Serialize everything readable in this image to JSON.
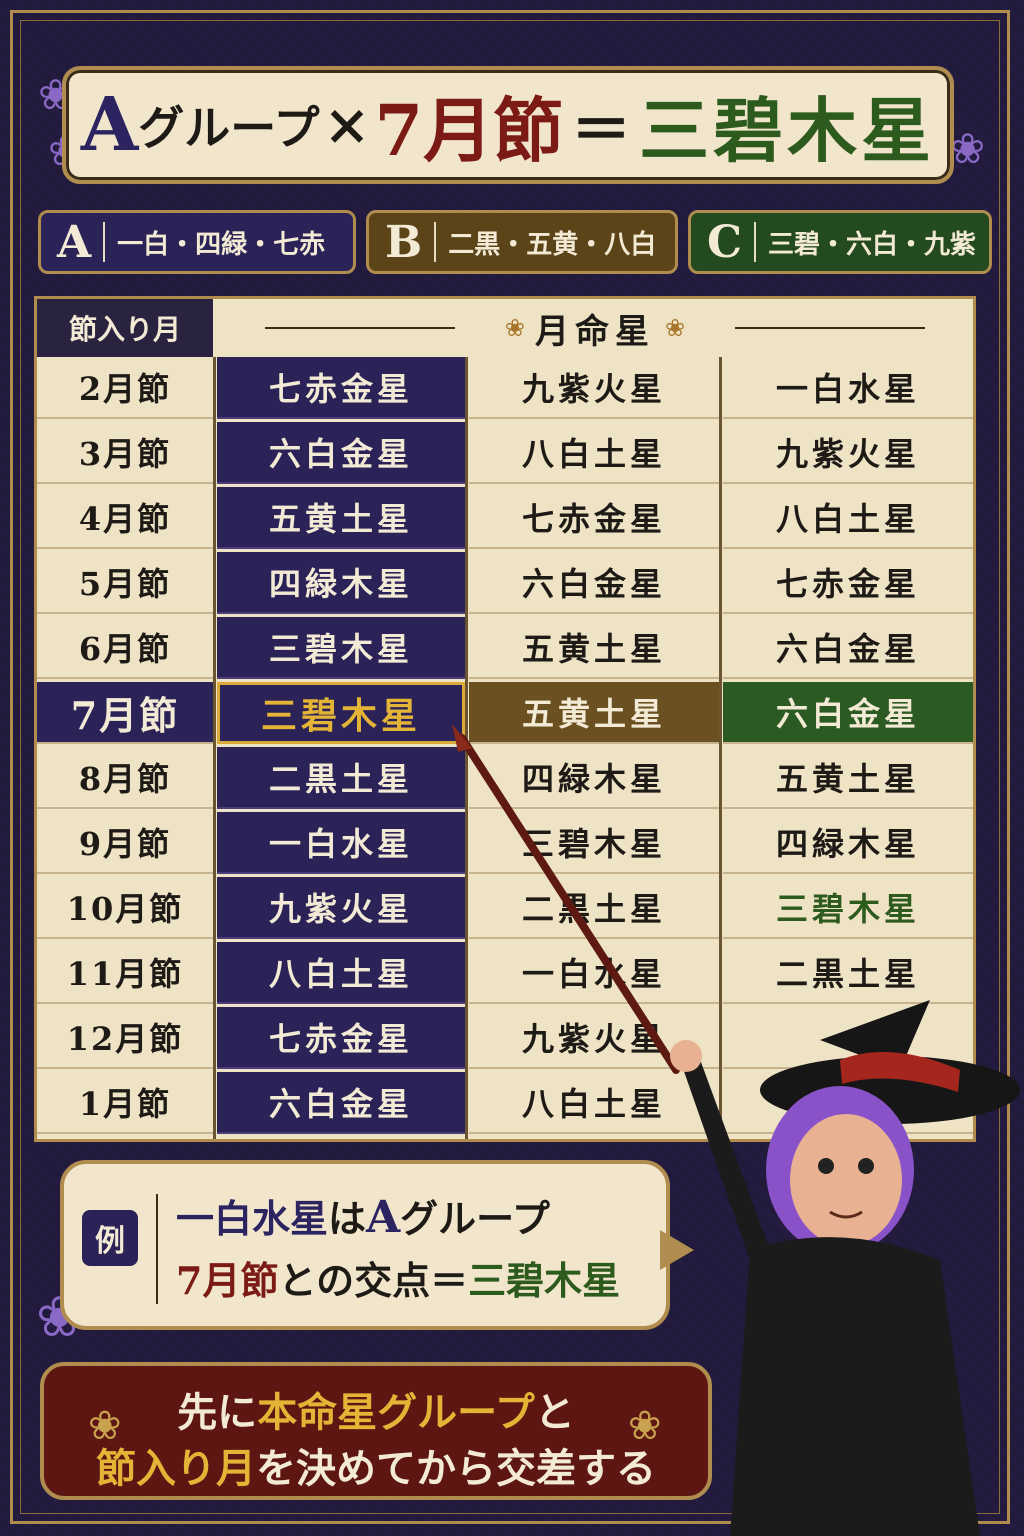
{
  "title": {
    "group_letter": "A",
    "group_word": "グループ",
    "times": "×",
    "month": "7月節",
    "equals": "＝",
    "result": "三碧木星"
  },
  "groups": [
    {
      "letter": "A",
      "stars": "一白・四緑・七赤",
      "color": "#2b2357"
    },
    {
      "letter": "B",
      "stars": "二黒・五黄・八白",
      "color": "#5c4419"
    },
    {
      "letter": "C",
      "stars": "三碧・六白・九紫",
      "color": "#244a1f"
    }
  ],
  "table": {
    "header_left": "節入り月",
    "header_right": "月命星",
    "rows": [
      {
        "month": "2月節",
        "a": "七赤金星",
        "b": "九紫火星",
        "c": "一白水星"
      },
      {
        "month": "3月節",
        "a": "六白金星",
        "b": "八白土星",
        "c": "九紫火星"
      },
      {
        "month": "4月節",
        "a": "五黄土星",
        "b": "七赤金星",
        "c": "八白土星"
      },
      {
        "month": "5月節",
        "a": "四緑木星",
        "b": "六白金星",
        "c": "七赤金星"
      },
      {
        "month": "6月節",
        "a": "三碧木星",
        "b": "五黄土星",
        "c": "六白金星"
      },
      {
        "month": "7月節",
        "a": "三碧木星",
        "b": "五黄土星",
        "c": "六白金星",
        "highlight": true
      },
      {
        "month": "8月節",
        "a": "二黒土星",
        "b": "四緑木星",
        "c": "五黄土星"
      },
      {
        "month": "9月節",
        "a": "一白水星",
        "b": "三碧木星",
        "c": "四緑木星"
      },
      {
        "month": "10月節",
        "a": "九紫火星",
        "b": "二黒土星",
        "c": "三碧木星"
      },
      {
        "month": "11月節",
        "a": "八白土星",
        "b": "一白水星",
        "c": "二黒土星"
      },
      {
        "month": "12月節",
        "a": "七赤金星",
        "b": "九紫火星",
        "c": ""
      },
      {
        "month": "1月節",
        "a": "六白金星",
        "b": "八白土星",
        "c": ""
      }
    ]
  },
  "example": {
    "badge": "例",
    "line1_star": "一白水星",
    "line1_mid": "は",
    "line1_group": "A",
    "line1_end": "グループ",
    "line2_month": "7月節",
    "line2_mid": "との交点＝",
    "line2_result": "三碧木星"
  },
  "banner": {
    "l1_a": "先に",
    "l1_b": "本命星グループ",
    "l1_c": "と",
    "l2_a": "節入り月",
    "l2_b": "を決めてから交差する"
  },
  "colors": {
    "navy": "#2b2357",
    "gold": "#b08d4e",
    "green": "#2d5a1d",
    "red": "#7c1a16"
  }
}
